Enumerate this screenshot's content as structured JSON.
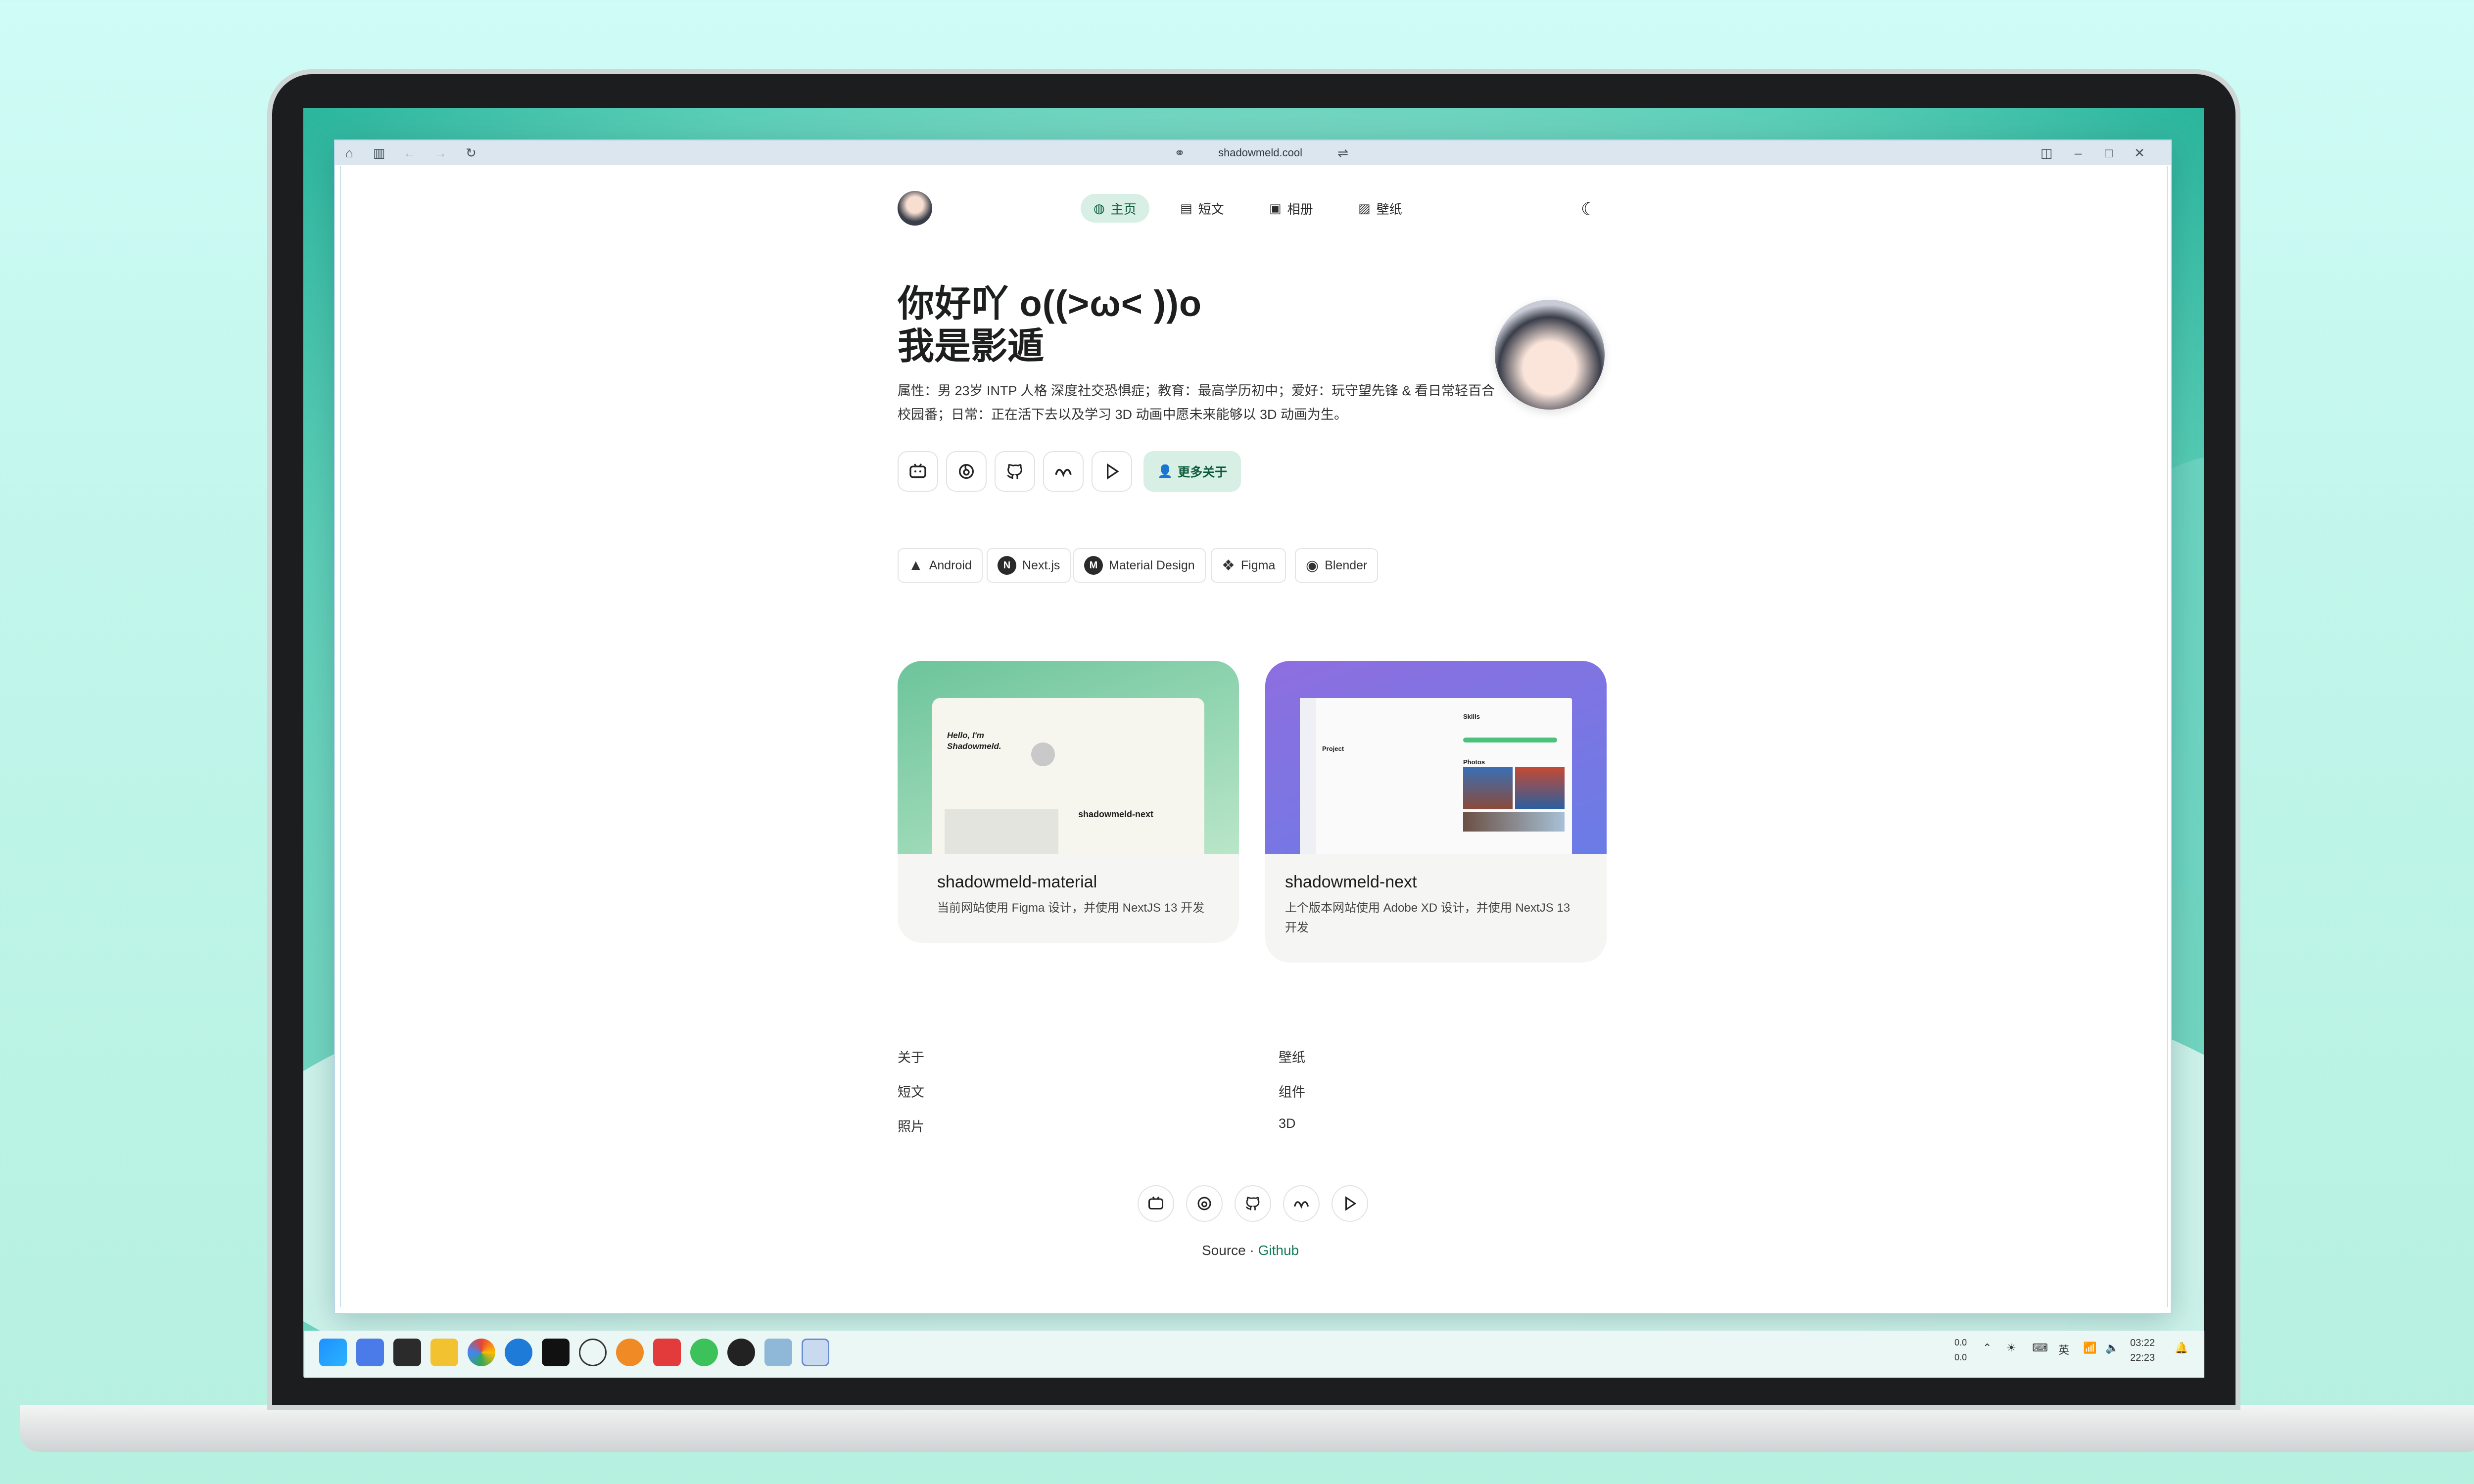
{
  "browser": {
    "url": "shadowmeld.cool"
  },
  "nav": {
    "items": [
      {
        "label": "主页",
        "icon": "home-icon",
        "active": true
      },
      {
        "label": "短文",
        "icon": "article-icon"
      },
      {
        "label": "相册",
        "icon": "album-icon"
      },
      {
        "label": "壁纸",
        "icon": "wallpaper-icon"
      }
    ],
    "theme_icon": "moon-icon"
  },
  "hero": {
    "line1": "你好吖 o((>ω< ))o",
    "line2": "我是影遁",
    "bio": "属性：男 23岁 INTP 人格 深度社交恐惧症；教育：最高学历初中；爱好：玩守望先锋 & 看日常轻百合校园番；日常：正在活下去以及学习 3D 动画中愿未来能够以 3D 动画为生。",
    "more_about": "更多关于"
  },
  "social": [
    "bilibili-icon",
    "netease-music-icon",
    "github-icon",
    "kuaishou-icon",
    "play-icon"
  ],
  "skills": [
    {
      "label": "Android",
      "icon": "android-icon"
    },
    {
      "label": "Next.js",
      "icon": "nextjs-icon",
      "glyph": "N"
    },
    {
      "label": "Material Design",
      "icon": "material-icon",
      "glyph": "M"
    },
    {
      "label": "Figma",
      "icon": "figma-icon"
    },
    {
      "label": "Blender",
      "icon": "blender-icon"
    }
  ],
  "projects": [
    {
      "title": "shadowmeld-material",
      "desc": "当前网站使用 Figma 设计，并使用 NextJS 13 开发",
      "preview_hello": "Hello, I'm Shadowmeld.",
      "preview_name": "shadowmeld-next",
      "colors": [
        "#6cc49b",
        "#b9e6c8"
      ]
    },
    {
      "title": "shadowmeld-next",
      "desc": "上个版本网站使用 Adobe XD 设计，并使用 NextJS 13 开发",
      "preview_project": "Project",
      "preview_photos": "Photos",
      "preview_skills": "Skills",
      "colors": [
        "#8e6ee0",
        "#6a7ce6"
      ]
    }
  ],
  "footer": {
    "col1": [
      "关于",
      "短文",
      "照片"
    ],
    "col2": [
      "壁纸",
      "组件",
      "3D"
    ],
    "source": "Source",
    "dot": "·",
    "source_link": "Github"
  },
  "taskbar": {
    "net_up": "0.0",
    "net_down": "0.0",
    "ime": "英",
    "time1": "03:22",
    "time2": "22:23"
  }
}
